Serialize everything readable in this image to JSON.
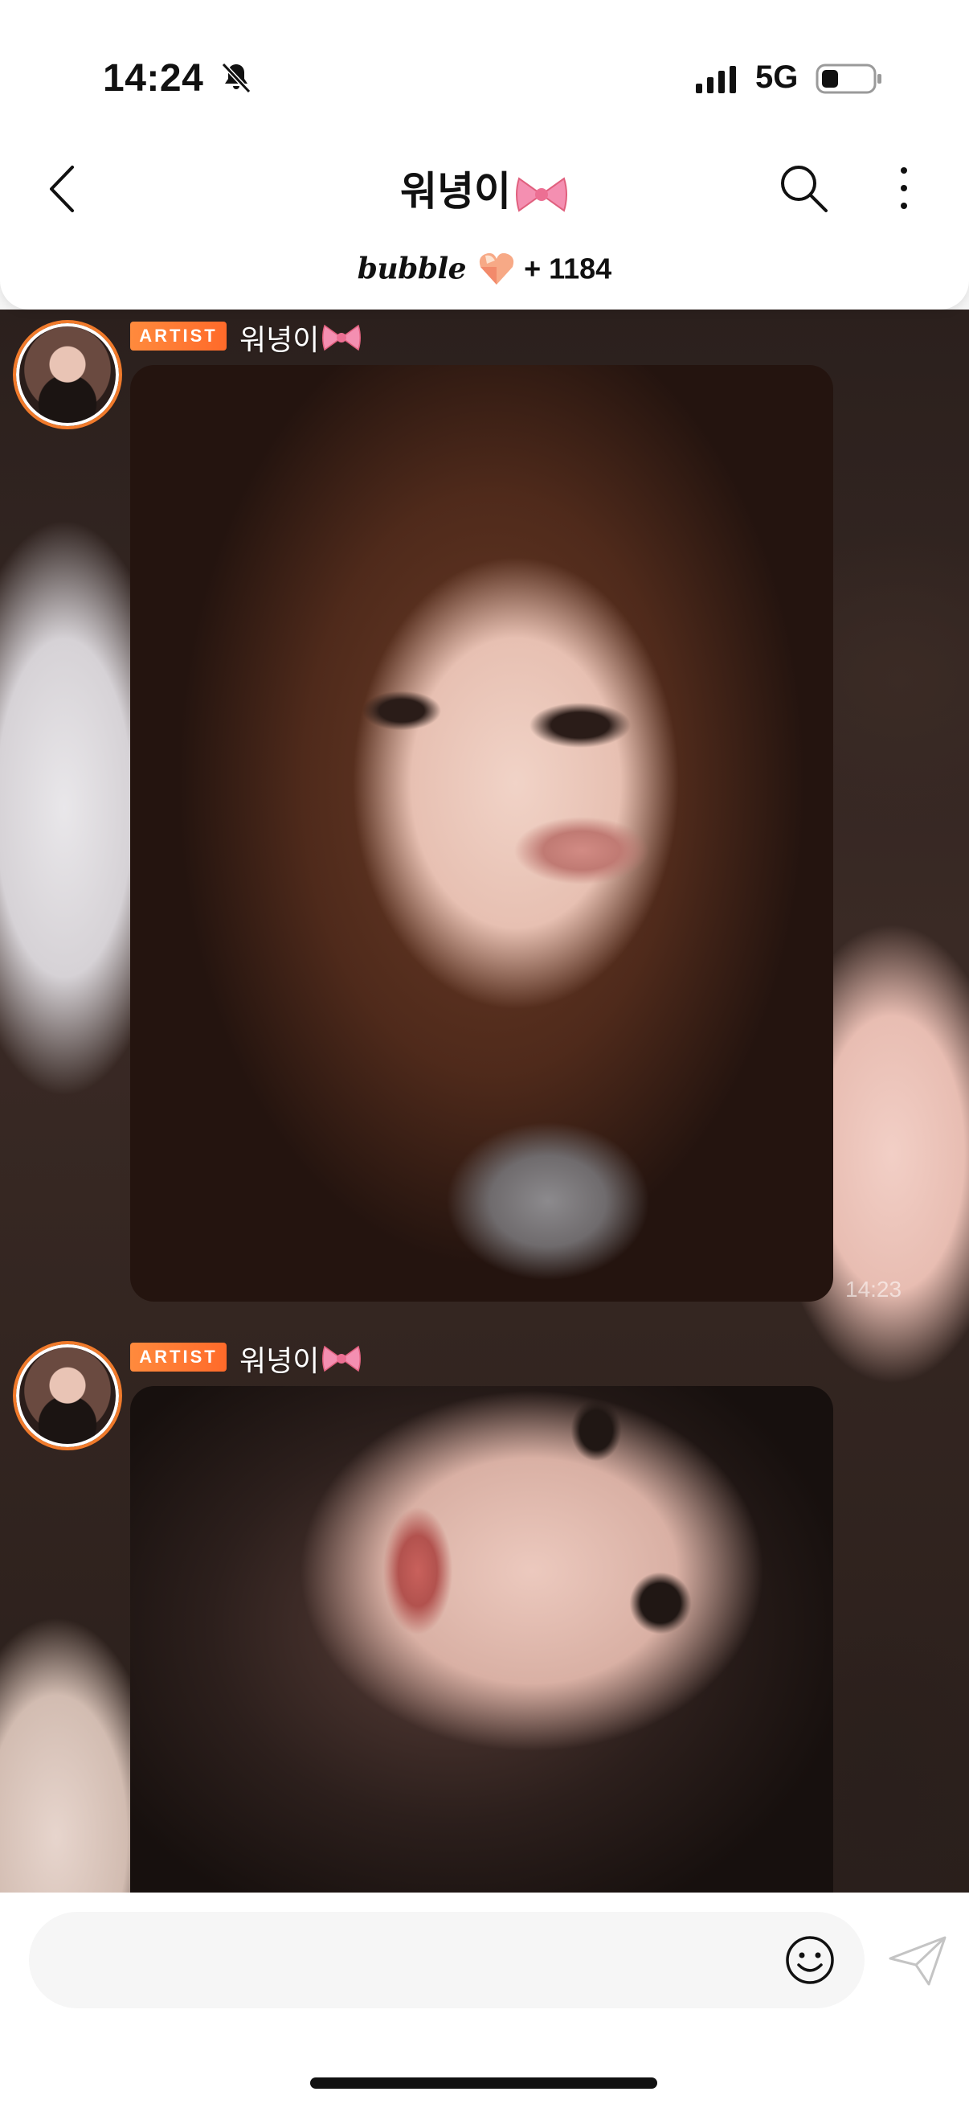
{
  "status_bar": {
    "time": "14:24",
    "network": "5G",
    "icons": [
      "bell-slash-icon",
      "signal-icon",
      "battery-icon"
    ]
  },
  "header": {
    "title": "워녕이",
    "title_emoji": "ribbon-bow-icon",
    "bubble_label": "bubble",
    "bubble_count": "+ 1184"
  },
  "messages": [
    {
      "badge": "ARTIST",
      "sender": "워녕이",
      "type": "photo",
      "time": "14:23"
    },
    {
      "badge": "ARTIST",
      "sender": "워녕이",
      "type": "photo",
      "time": ""
    }
  ],
  "composer": {
    "value": "",
    "placeholder": ""
  },
  "colors": {
    "accent": "#f07a2b",
    "badge": "#ff7a33",
    "background": "#ffffff"
  }
}
